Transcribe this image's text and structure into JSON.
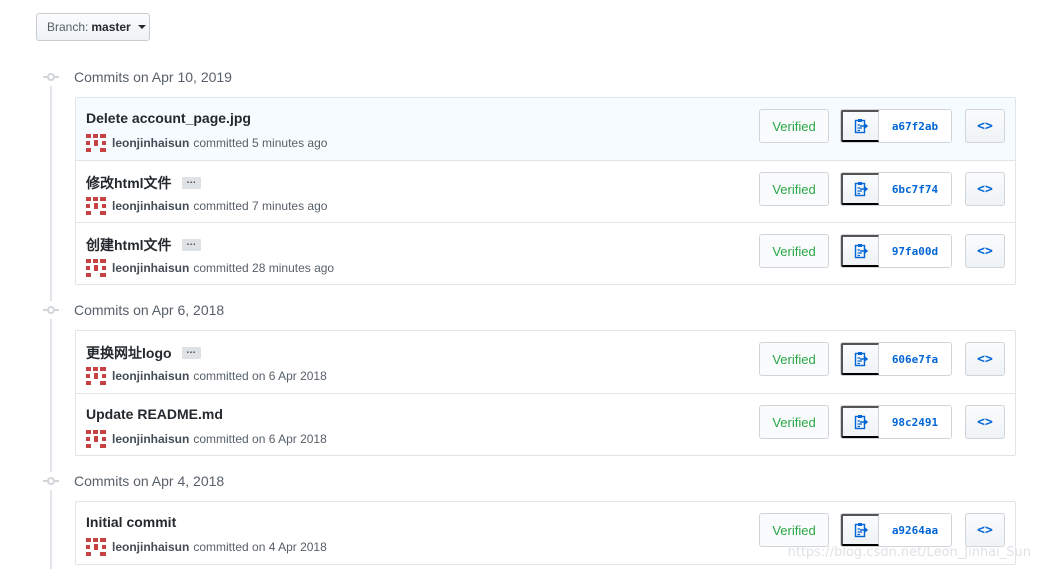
{
  "branch": {
    "label": "Branch:",
    "value": "master"
  },
  "groups": [
    {
      "title": "Commits on Apr 10, 2019",
      "commits": [
        {
          "message": "Delete account_page.jpg",
          "has_more": false,
          "author": "leonjinhaisun",
          "action": "committed",
          "time": "5 minutes ago",
          "verified": "Verified",
          "sha": "a67f2ab",
          "highlight": true
        },
        {
          "message": "修改html文件",
          "has_more": true,
          "author": "leonjinhaisun",
          "action": "committed",
          "time": "7 minutes ago",
          "verified": "Verified",
          "sha": "6bc7f74",
          "highlight": false
        },
        {
          "message": "创建html文件",
          "has_more": true,
          "author": "leonjinhaisun",
          "action": "committed",
          "time": "28 minutes ago",
          "verified": "Verified",
          "sha": "97fa00d",
          "highlight": false
        }
      ]
    },
    {
      "title": "Commits on Apr 6, 2018",
      "commits": [
        {
          "message": "更换网址logo",
          "has_more": true,
          "author": "leonjinhaisun",
          "action": "committed on",
          "time": "6 Apr 2018",
          "verified": "Verified",
          "sha": "606e7fa",
          "highlight": false
        },
        {
          "message": "Update README.md",
          "has_more": false,
          "author": "leonjinhaisun",
          "action": "committed on",
          "time": "6 Apr 2018",
          "verified": "Verified",
          "sha": "98c2491",
          "highlight": false
        }
      ]
    },
    {
      "title": "Commits on Apr 4, 2018",
      "commits": [
        {
          "message": "Initial commit",
          "has_more": false,
          "author": "leonjinhaisun",
          "action": "committed on",
          "time": "4 Apr 2018",
          "verified": "Verified",
          "sha": "a9264aa",
          "highlight": false
        }
      ]
    }
  ],
  "ellipsis_label": "…",
  "browse_label": "<>",
  "watermark": "https://blog.csdn.net/Leon_Jinhai_Sun",
  "colors": {
    "verified": "#28a745",
    "sha": "#0366d6",
    "avatar": "#c74343"
  }
}
